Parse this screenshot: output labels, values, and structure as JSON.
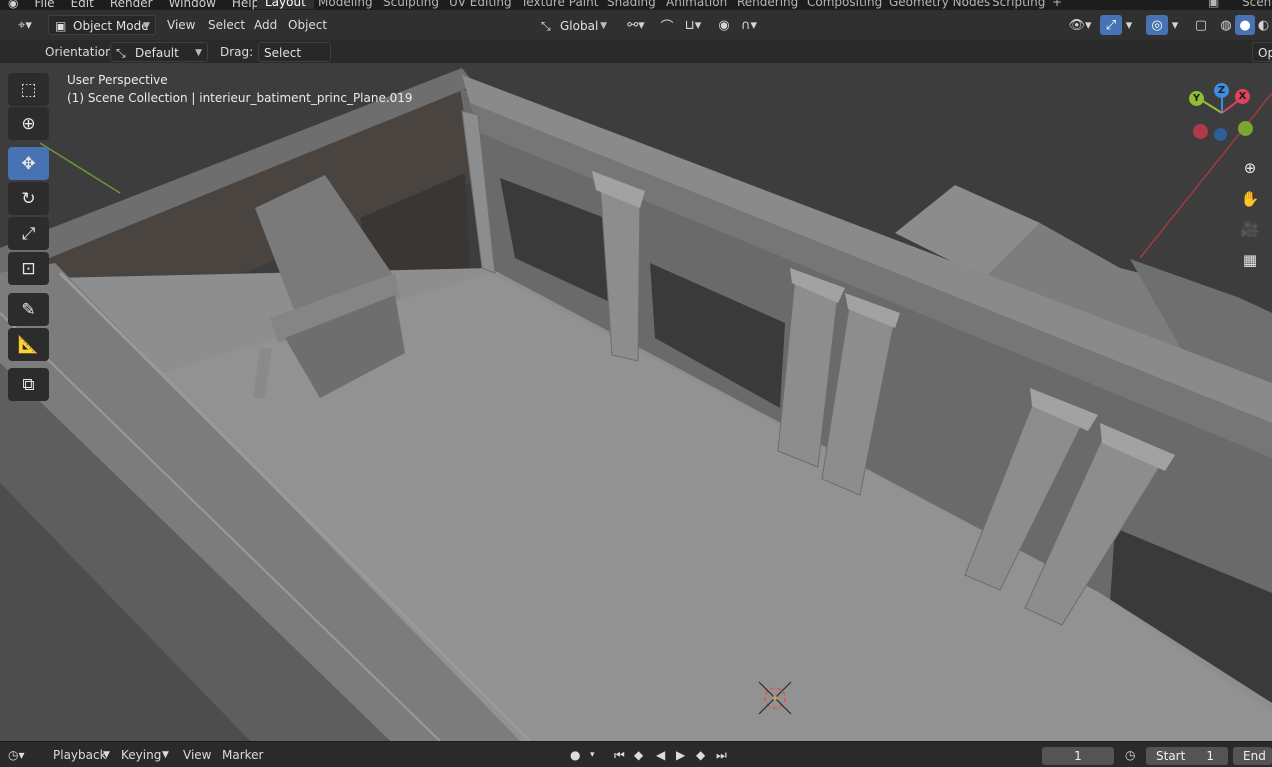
{
  "app_menu": [
    "File",
    "Edit",
    "Render",
    "Window",
    "Help"
  ],
  "workspace_tabs": [
    "Layout",
    "Modeling",
    "Sculpting",
    "UV Editing",
    "Texture Paint",
    "Shading",
    "Animation",
    "Rendering",
    "Compositing",
    "Geometry Nodes",
    "Scripting"
  ],
  "scene_label": "Scene",
  "header": {
    "mode": "Object Mode",
    "menus": [
      "View",
      "Select",
      "Add",
      "Object"
    ],
    "transform_orientation": "Global"
  },
  "tool_settings": {
    "orientation_label": "Orientation:",
    "orientation_value": "Default",
    "drag_label": "Drag:",
    "drag_value": "Select Box",
    "options_label": "Op"
  },
  "viewport": {
    "perspective": "User Perspective",
    "collection_info": "(1) Scene Collection | interieur_batiment_princ_Plane.019"
  },
  "toolbar_tools": [
    {
      "name": "select-box-icon",
      "active": false
    },
    {
      "name": "cursor-icon",
      "active": false
    },
    {
      "name": "move-icon",
      "active": true
    },
    {
      "name": "rotate-icon",
      "active": false
    },
    {
      "name": "scale-icon",
      "active": false
    },
    {
      "name": "transform-icon",
      "active": false
    },
    {
      "name": "annotate-icon",
      "active": false
    },
    {
      "name": "measure-icon",
      "active": false
    },
    {
      "name": "add-cube-icon",
      "active": false
    }
  ],
  "gizmo": {
    "x": "X",
    "y": "Y",
    "z": "Z"
  },
  "timeline": {
    "menus": [
      "Playback",
      "Keying",
      "View",
      "Marker"
    ],
    "current_frame": "1",
    "start_label": "Start",
    "start_value": "1",
    "end_label": "End"
  },
  "colors": {
    "accent": "#4772b3",
    "x_axis": "#e0445c",
    "y_axis": "#8fbd35",
    "z_axis": "#3c8ee3"
  }
}
